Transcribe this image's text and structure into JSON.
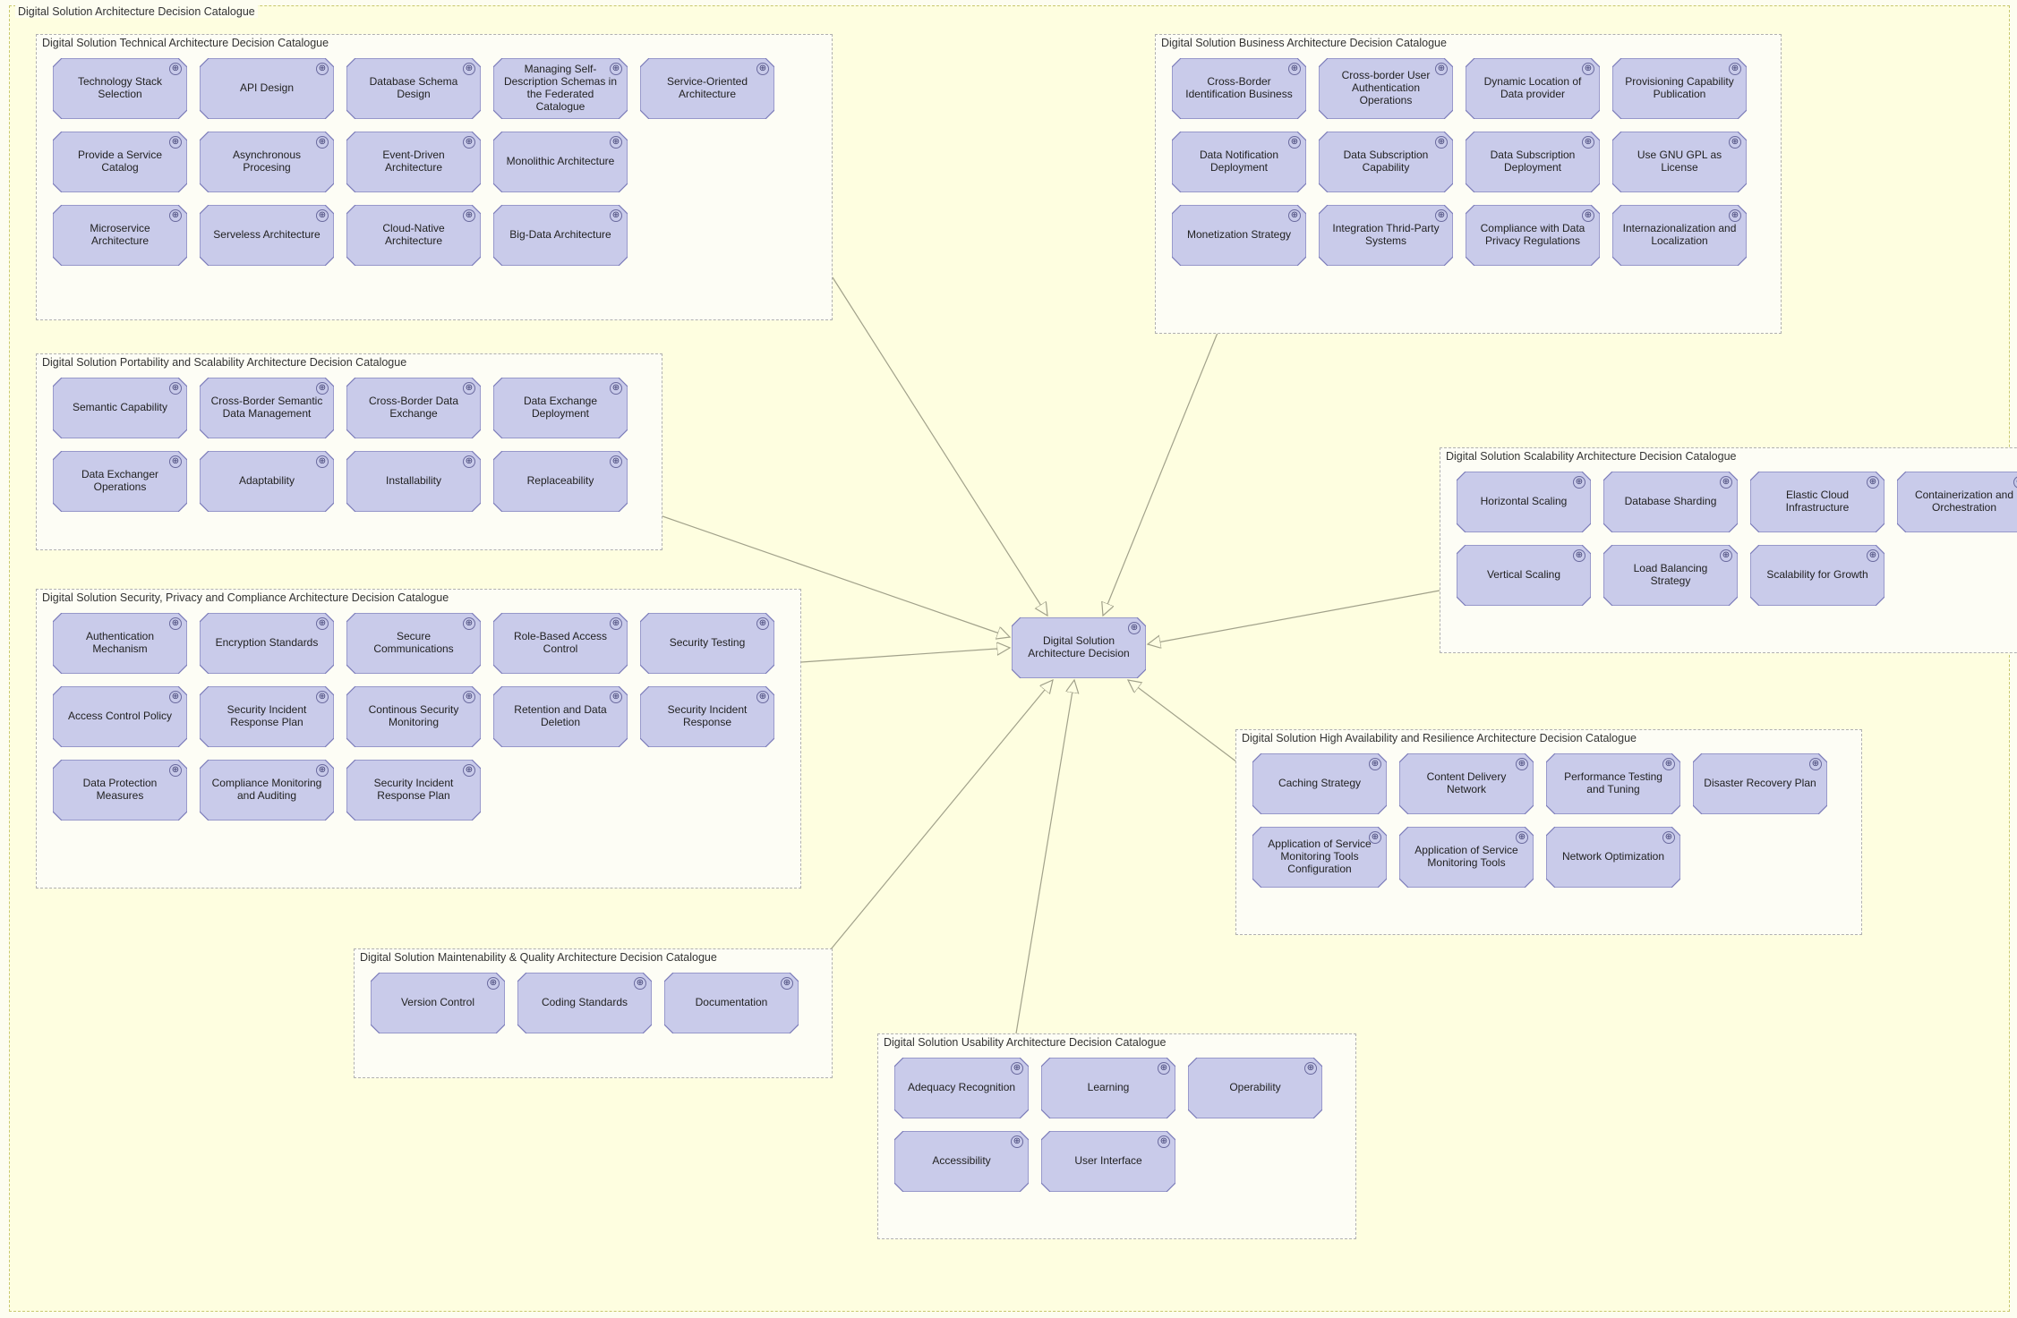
{
  "outer": {
    "label": "Digital Solution Architecture Decision Catalogue"
  },
  "center": {
    "label": "Digital Solution Architecture Decision"
  },
  "groups": {
    "technical": {
      "title": "Digital Solution Technical Architecture Decision Catalogue",
      "nodes": [
        "Technology Stack Selection",
        "API Design",
        "Database Schema Design",
        "Managing Self-Description Schemas in the Federated Catalogue",
        "Service-Oriented Architecture",
        "Provide a Service Catalog",
        "Asynchronous Procesing",
        "Event-Driven Architecture",
        "Monolithic Architecture",
        "",
        "Microservice Architecture",
        "Serveless Architecture",
        "Cloud-Native Architecture",
        "Big-Data Architecture",
        ""
      ]
    },
    "business": {
      "title": "Digital Solution Business Architecture Decision Catalogue",
      "nodes": [
        "Cross-Border Identification Business",
        "Cross-border User Authentication Operations",
        "Dynamic Location of Data provider",
        "Provisioning Capability Publication",
        "Data Notification Deployment",
        "Data Subscription Capability",
        "Data Subscription Deployment",
        "Use GNU GPL as License",
        "Monetization Strategy",
        "Integration Thrid-Party Systems",
        "Compliance with Data Privacy Regulations",
        "Internazionalization and Localization"
      ]
    },
    "portscale": {
      "title": "Digital Solution Portability and Scalability Architecture Decision Catalogue",
      "nodes": [
        "Semantic Capability",
        "Cross-Border Semantic Data Management",
        "Cross-Border Data Exchange",
        "Data Exchange Deployment",
        "Data Exchanger Operations",
        "Adaptability",
        "Installability",
        "Replaceability"
      ]
    },
    "security": {
      "title": "Digital Solution Security, Privacy and Compliance Architecture Decision Catalogue",
      "nodes": [
        "Authentication Mechanism",
        "Encryption Standards",
        "Secure Communications",
        "Role-Based Access Control",
        "Security Testing",
        "Access Control Policy",
        "Security Incident Response Plan",
        "Continous Security Monitoring",
        "Retention and Data Deletion",
        "Security Incident Response",
        "Data Protection Measures",
        "Compliance Monitoring and Auditing",
        "Security Incident Response Plan",
        "",
        ""
      ]
    },
    "maint": {
      "title": "Digital Solution Maintenability & Quality Architecture Decision Catalogue",
      "nodes": [
        "Version Control",
        "Coding Standards",
        "Documentation"
      ]
    },
    "usability": {
      "title": "Digital Solution Usability Architecture Decision Catalogue",
      "nodes": [
        "Adequacy Recognition",
        "Learning",
        "Operability",
        "Accessibility",
        "User Interface",
        ""
      ]
    },
    "scalability": {
      "title": "Digital Solution Scalability Architecture Decision Catalogue",
      "nodes": [
        "Horizontal Scaling",
        "Database Sharding",
        "Elastic Cloud Infrastructure",
        "Containerization and Orchestration",
        "Vertical Scaling",
        "Load Balancing Strategy",
        "Scalability for Growth",
        ""
      ]
    },
    "ha": {
      "title": "Digital Solution High Availability and Resilience Architecture Decision Catalogue",
      "nodes": [
        "Caching Strategy",
        "Content Delivery Network",
        "Performance Testing and Tuning",
        "Disaster Recovery Plan",
        "Application of Service Monitoring Tools Configuration",
        "Application of Service Monitoring Tools",
        "Network Optimization",
        ""
      ]
    }
  }
}
